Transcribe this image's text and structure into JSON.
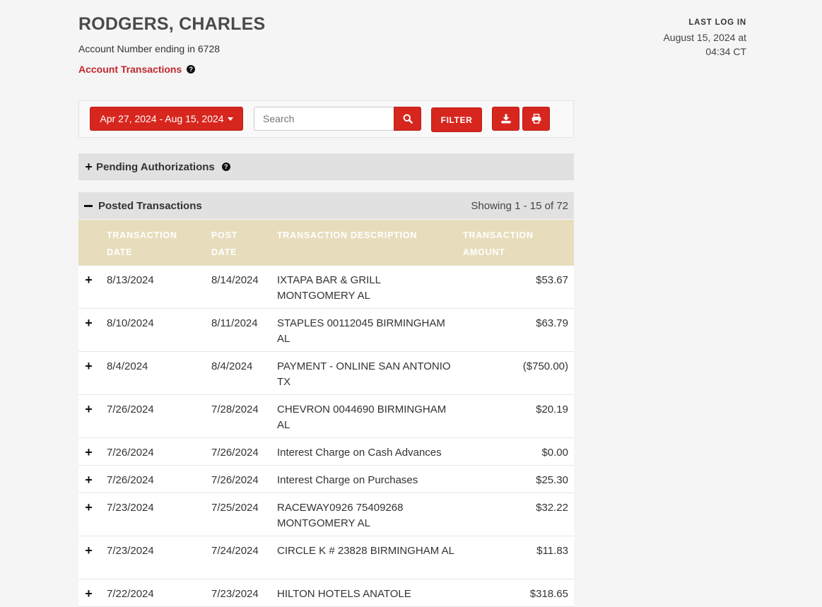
{
  "header": {
    "account_name": "RODGERS, CHARLES",
    "account_number": "Account Number ending in 6728",
    "tx_link": "Account Transactions",
    "help_glyph": "?"
  },
  "last_login": {
    "label": "LAST LOG IN",
    "line1": "August 15, 2024 at",
    "line2": "04:34 CT"
  },
  "toolbar": {
    "date_range": "Apr 27, 2024 - Aug 15, 2024",
    "search_placeholder": "Search",
    "filter_label": "FILTER",
    "icons": [
      "search-icon",
      "download-icon",
      "print-icon"
    ]
  },
  "pending": {
    "title": "Pending Authorizations"
  },
  "posted": {
    "title": "Posted Transactions",
    "showing": "Showing 1 - 15 of 72"
  },
  "table": {
    "headers": {
      "transaction_date": "TRANSACTION DATE",
      "post_date": "POST DATE",
      "description": "TRANSACTION DESCRIPTION",
      "amount": "TRANSACTION AMOUNT"
    },
    "rows": [
      {
        "tdate": "8/13/2024",
        "pdate": "8/14/2024",
        "desc": "IXTAPA BAR & GRILL MONTGOMERY AL",
        "amount": "$53.67"
      },
      {
        "tdate": "8/10/2024",
        "pdate": "8/11/2024",
        "desc": "STAPLES 00112045 BIRMINGHAM AL",
        "amount": "$63.79"
      },
      {
        "tdate": "8/4/2024",
        "pdate": "8/4/2024",
        "desc": "PAYMENT - ONLINE SAN ANTONIO TX",
        "amount": "($750.00)"
      },
      {
        "tdate": "7/26/2024",
        "pdate": "7/28/2024",
        "desc": "CHEVRON 0044690 BIRMINGHAM AL",
        "amount": "$20.19"
      },
      {
        "tdate": "7/26/2024",
        "pdate": "7/26/2024",
        "desc": "Interest Charge on Cash Advances",
        "amount": "$0.00"
      },
      {
        "tdate": "7/26/2024",
        "pdate": "7/26/2024",
        "desc": "Interest Charge on Purchases",
        "amount": "$25.30"
      },
      {
        "tdate": "7/23/2024",
        "pdate": "7/25/2024",
        "desc": "RACEWAY0926 75409268 MONTGOMERY AL",
        "amount": "$32.22"
      },
      {
        "tdate": "7/23/2024",
        "pdate": "7/24/2024",
        "desc": "CIRCLE K # 23828 BIRMINGHAM AL",
        "amount": "$11.83"
      },
      {
        "tdate": "7/22/2024",
        "pdate": "7/23/2024",
        "desc": "HILTON HOTELS ANATOLE",
        "amount": "$318.65"
      }
    ]
  },
  "colors": {
    "accent_red": "#d7261e",
    "link_red": "#c1272d",
    "header_tan": "#e7ddbd",
    "section_gray": "#e1e1e1"
  }
}
